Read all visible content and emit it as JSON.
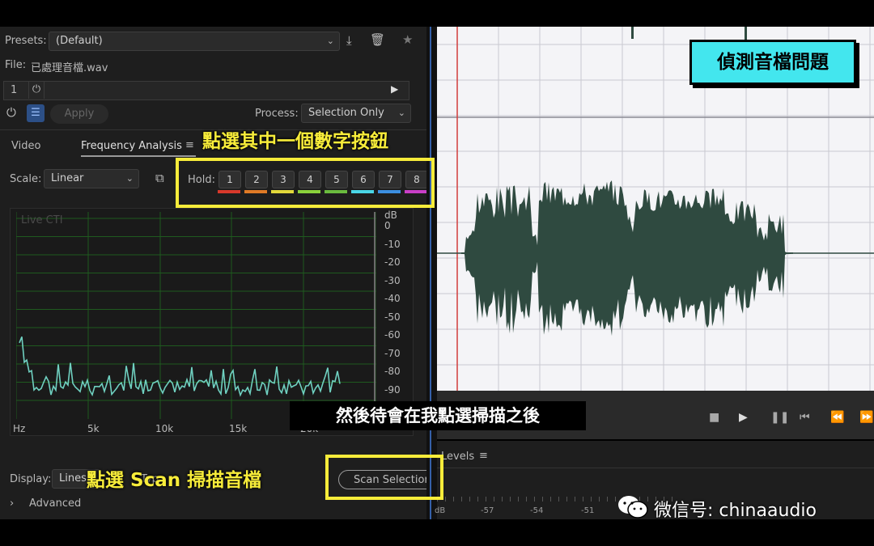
{
  "presets": {
    "label": "Presets:",
    "value": "(Default)"
  },
  "file": {
    "label": "File:",
    "name": "已處理音檔.wav"
  },
  "effect_rack": {
    "slot_number": "1"
  },
  "apply_label": "Apply",
  "process": {
    "label": "Process:",
    "value": "Selection Only"
  },
  "tabs": {
    "video": "Video",
    "frequency_analysis": "Frequency Analysis"
  },
  "scale": {
    "label": "Scale:",
    "value": "Linear"
  },
  "hold": {
    "label": "Hold:",
    "buttons": [
      "1",
      "2",
      "3",
      "4",
      "5",
      "6",
      "7",
      "8"
    ],
    "colors": [
      "#d8392b",
      "#e07a26",
      "#e2d83a",
      "#8ad23b",
      "#6abb3e",
      "#4ad6e6",
      "#3c8fe0",
      "#c93fc7"
    ]
  },
  "chart": {
    "overlay_label": "Live CTI",
    "db_unit": "dB",
    "db_ticks": [
      "0",
      "-10",
      "-20",
      "-30",
      "-40",
      "-50",
      "-60",
      "-70",
      "-80",
      "-90"
    ],
    "hz_ticks": [
      "Hz",
      "5k",
      "10k",
      "15k",
      "20k"
    ],
    "line_color": "#6fd0c0"
  },
  "display": {
    "label": "Display:",
    "value": "Lines",
    "hidden_text": "Typ"
  },
  "scan_button": "Scan Selection",
  "advanced_label": "Advanced",
  "levels": {
    "label": "Levels",
    "scale_ticks": [
      "dB",
      "-57",
      "-54",
      "-51"
    ]
  },
  "annotations": {
    "title": "偵測音檔問題",
    "click_number": "點選其中一個數字按鈕",
    "click_scan": "點選 Scan 掃描音檔",
    "subtitle": "然後待會在我點選掃描之後"
  },
  "watermark": "微信号: chinaaudio"
}
